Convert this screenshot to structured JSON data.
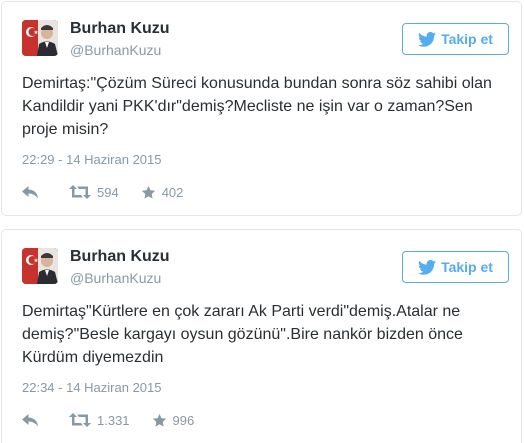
{
  "colors": {
    "accent": "#55acee",
    "muted": "#8899a6",
    "text": "#292f33",
    "border": "#e1e8ed",
    "flag_red": "#e30a17"
  },
  "icons": {
    "follow": "twitter-bird-icon",
    "reply": "reply-icon",
    "retweet": "retweet-icon",
    "favorite": "star-icon"
  },
  "tweets": [
    {
      "author": "Burhan Kuzu",
      "handle": "@BurhanKuzu",
      "follow_label": "Takip et",
      "text": "Demirtaş:\"Çözüm Süreci konusunda bundan sonra söz sahibi olan Kandildir yani PKK'dır\"demiş?Mecliste ne işin var o zaman?Sen proje misin?",
      "timestamp": "22:29 - 14 Haziran 2015",
      "retweets": "594",
      "favorites": "402"
    },
    {
      "author": "Burhan Kuzu",
      "handle": "@BurhanKuzu",
      "follow_label": "Takip et",
      "text": "Demirtaş\"Kürtlere en çok zararı Ak Parti verdi\"demiş.Atalar ne demiş?\"Besle kargayı oysun gözünü\".Bire nankör bizden önce Kürdüm diyemezdin",
      "timestamp": "22:34 - 14 Haziran 2015",
      "retweets": "1.331",
      "favorites": "996"
    }
  ]
}
